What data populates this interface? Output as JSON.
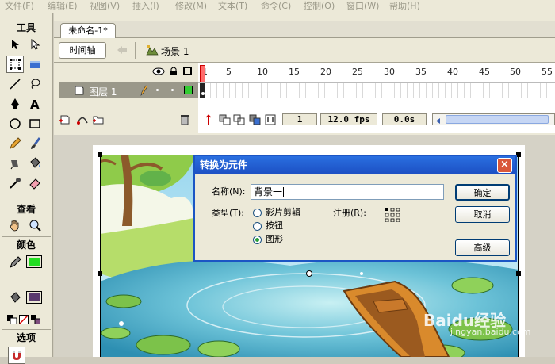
{
  "menu": [
    "文件(F)",
    "编辑(E)",
    "视图(V)",
    "插入(I)",
    "修改(M)",
    "文本(T)",
    "命令(C)",
    "控制(O)",
    "窗口(W)",
    "帮助(H)"
  ],
  "tools": {
    "title": "工具",
    "view_label": "查看",
    "colors_label": "颜色",
    "options_label": "选项",
    "stroke_color": "#22dd22",
    "fill_color": "#5a3a6e"
  },
  "document": {
    "tab_title": "未命名-1*",
    "timeline_button": "时间轴",
    "scene_label": "场景 1"
  },
  "timeline": {
    "frame_numbers": [
      "1",
      "5",
      "10",
      "15",
      "20",
      "25",
      "30",
      "35",
      "40",
      "45",
      "50",
      "55"
    ],
    "layer_name": "图层 1",
    "current_frame": "1",
    "frame_rate": "12.0 fps",
    "elapsed_time": "0.0s"
  },
  "dialog": {
    "title": "转换为元件",
    "name_label": "名称(N):",
    "name_value": "背景一",
    "type_label": "类型(T):",
    "types": [
      {
        "label": "影片剪辑",
        "selected": false
      },
      {
        "label": "按钮",
        "selected": false
      },
      {
        "label": "图形",
        "selected": true
      }
    ],
    "registration_label": "注册(R):",
    "ok_button": "确定",
    "cancel_button": "取消",
    "advanced_button": "高级"
  },
  "watermark": {
    "brand": "Baidu经验",
    "url": "jingyan.baidu.com"
  }
}
